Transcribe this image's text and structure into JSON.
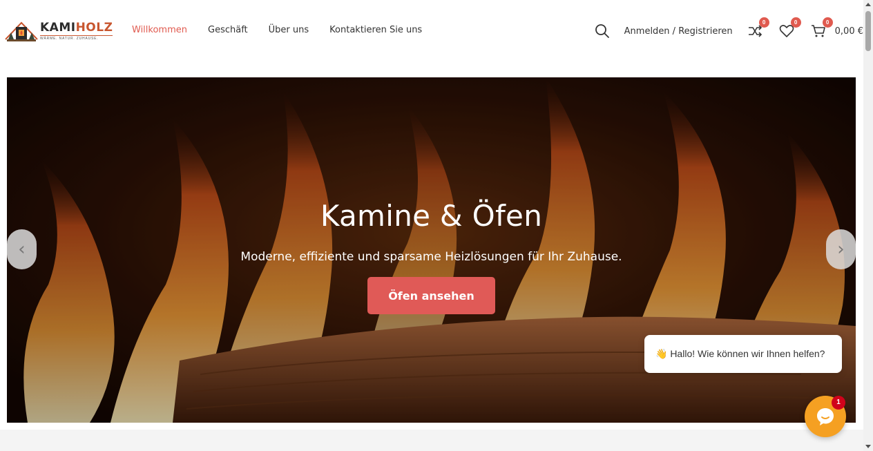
{
  "brand": {
    "name_part1": "KAMI",
    "name_part2": "HOLZ",
    "tagline": "WÄRME. NATUR. ZUHAUSE.",
    "accent_color": "#c8562f"
  },
  "nav": {
    "items": [
      {
        "label": "Willkommen",
        "active": true
      },
      {
        "label": "Geschäft",
        "active": false
      },
      {
        "label": "Über uns",
        "active": false
      },
      {
        "label": "Kontaktieren Sie uns",
        "active": false
      }
    ],
    "active_color": "#e05a4f"
  },
  "header_right": {
    "search_icon": "search-icon",
    "login_label": "Anmelden / Registrieren",
    "compare_count": "0",
    "wishlist_count": "0",
    "cart_count": "0",
    "cart_total": "0,00 €"
  },
  "hero": {
    "title": "Kamine & Öfen",
    "subtitle": "Moderne, effiziente und sparsame Heizlösungen für Ihr Zuhause.",
    "button_label": "Öfen ansehen",
    "button_color": "#e05a57",
    "prev_arrow": "‹",
    "next_arrow": "›"
  },
  "chat": {
    "greeting": "👋 Hallo! Wie können wir Ihnen helfen?",
    "unread_count": "1",
    "button_color": "#f5a022"
  }
}
